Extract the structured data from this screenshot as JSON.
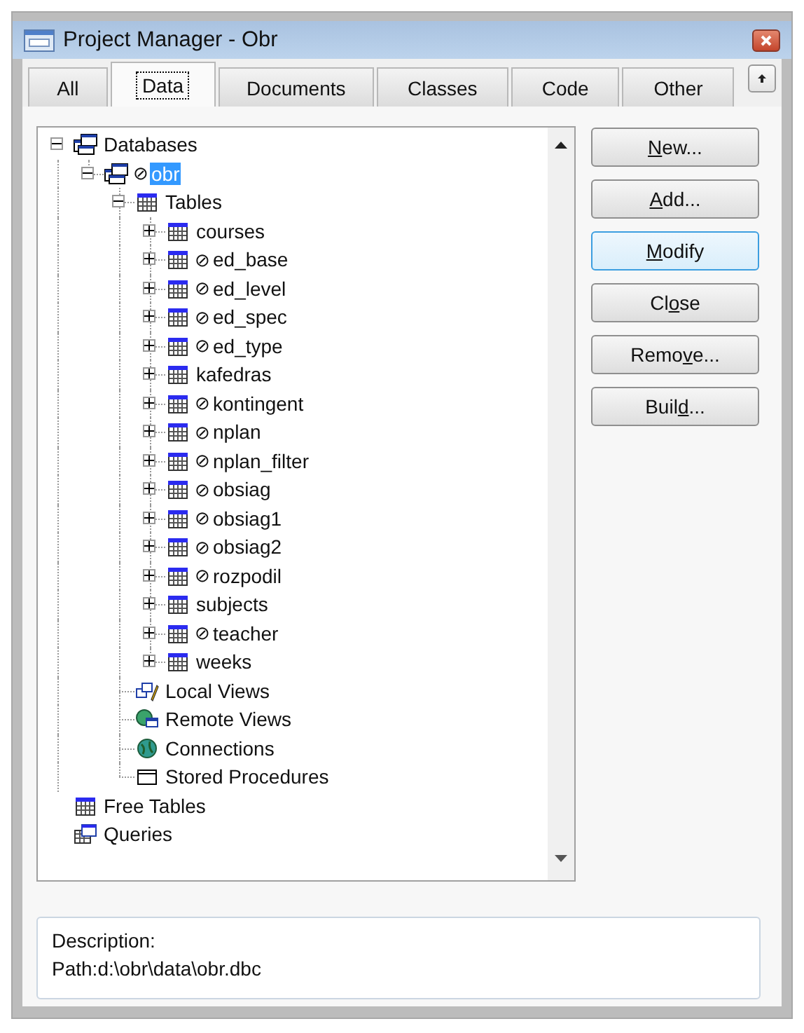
{
  "window": {
    "title": "Project Manager - Obr"
  },
  "tabs": [
    {
      "label": "All",
      "selected": false
    },
    {
      "label": "Data",
      "selected": true
    },
    {
      "label": "Documents",
      "selected": false
    },
    {
      "label": "Classes",
      "selected": false
    },
    {
      "label": "Code",
      "selected": false
    },
    {
      "label": "Other",
      "selected": false
    }
  ],
  "tree": [
    {
      "label": "Databases",
      "kind": "database",
      "expanded": true,
      "selected": false,
      "children": [
        {
          "label": "obr",
          "marker": "⊘",
          "kind": "database",
          "expanded": true,
          "selected": true,
          "children": [
            {
              "label": "Tables",
              "kind": "table",
              "expanded": true,
              "selected": false,
              "children": [
                {
                  "label": "courses",
                  "kind": "table",
                  "expanded": false,
                  "selected": false
                },
                {
                  "label": "ed_base",
                  "marker": "⊘",
                  "kind": "table",
                  "expanded": false,
                  "selected": false
                },
                {
                  "label": "ed_level",
                  "marker": "⊘",
                  "kind": "table",
                  "expanded": false,
                  "selected": false
                },
                {
                  "label": "ed_spec",
                  "marker": "⊘",
                  "kind": "table",
                  "expanded": false,
                  "selected": false
                },
                {
                  "label": "ed_type",
                  "marker": "⊘",
                  "kind": "table",
                  "expanded": false,
                  "selected": false
                },
                {
                  "label": "kafedras",
                  "kind": "table",
                  "expanded": false,
                  "selected": false
                },
                {
                  "label": "kontingent",
                  "marker": "⊘",
                  "kind": "table",
                  "expanded": false,
                  "selected": false
                },
                {
                  "label": "nplan",
                  "marker": "⊘",
                  "kind": "table",
                  "expanded": false,
                  "selected": false
                },
                {
                  "label": "nplan_filter",
                  "marker": "⊘",
                  "kind": "table",
                  "expanded": false,
                  "selected": false
                },
                {
                  "label": "obsiag",
                  "marker": "⊘",
                  "kind": "table",
                  "expanded": false,
                  "selected": false
                },
                {
                  "label": "obsiag1",
                  "marker": "⊘",
                  "kind": "table",
                  "expanded": false,
                  "selected": false
                },
                {
                  "label": "obsiag2",
                  "marker": "⊘",
                  "kind": "table",
                  "expanded": false,
                  "selected": false
                },
                {
                  "label": "rozpodil",
                  "marker": "⊘",
                  "kind": "table",
                  "expanded": false,
                  "selected": false
                },
                {
                  "label": "subjects",
                  "kind": "table",
                  "expanded": false,
                  "selected": false
                },
                {
                  "label": "teacher",
                  "marker": "⊘",
                  "kind": "table",
                  "expanded": false,
                  "selected": false
                },
                {
                  "label": "weeks",
                  "kind": "table",
                  "expanded": false,
                  "selected": false
                }
              ]
            },
            {
              "label": "Local Views",
              "kind": "local-view",
              "selected": false
            },
            {
              "label": "Remote Views",
              "kind": "remote-view",
              "selected": false
            },
            {
              "label": "Connections",
              "kind": "connection",
              "selected": false
            },
            {
              "label": "Stored Procedures",
              "kind": "procedure",
              "selected": false
            }
          ]
        }
      ]
    },
    {
      "label": "Free Tables",
      "kind": "table",
      "selected": false
    },
    {
      "label": "Queries",
      "kind": "query",
      "selected": false
    }
  ],
  "buttons": [
    {
      "parts": [
        {
          "text": "N",
          "key": true
        },
        {
          "text": "ew...",
          "key": false
        }
      ],
      "focused": false
    },
    {
      "parts": [
        {
          "text": "A",
          "key": true
        },
        {
          "text": "dd...",
          "key": false
        }
      ],
      "focused": false
    },
    {
      "parts": [
        {
          "text": "M",
          "key": true
        },
        {
          "text": "odify",
          "key": false
        }
      ],
      "focused": true
    },
    {
      "parts": [
        {
          "text": "Cl",
          "key": false
        },
        {
          "text": "o",
          "key": true
        },
        {
          "text": "se",
          "key": false
        }
      ],
      "focused": false
    },
    {
      "parts": [
        {
          "text": "Remo",
          "key": false
        },
        {
          "text": "v",
          "key": true
        },
        {
          "text": "e...",
          "key": false
        }
      ],
      "focused": false
    },
    {
      "parts": [
        {
          "text": "Buil",
          "key": false
        },
        {
          "text": "d",
          "key": true
        },
        {
          "text": "...",
          "key": false
        }
      ],
      "focused": false
    }
  ],
  "description": {
    "label": "Description:",
    "path": "Path:d:\\obr\\data\\obr.dbc"
  }
}
